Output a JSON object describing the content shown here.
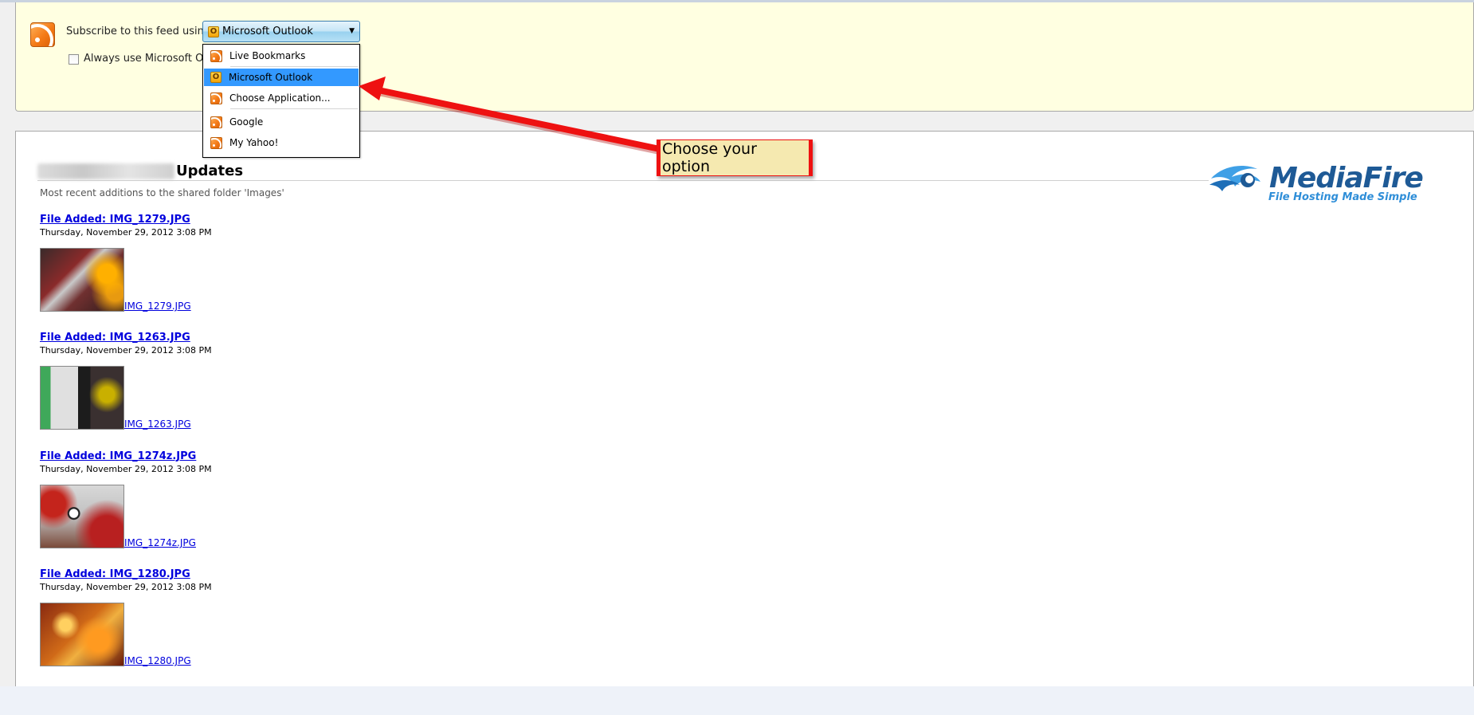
{
  "subscribe": {
    "label": "Subscribe to this feed using",
    "selected_value": "Microsoft Outlook",
    "always_use_label": "Always use Microsoft Outlook to subscribe to feeds.",
    "always_use_checked": false
  },
  "menu": {
    "items": [
      {
        "label": "Live Bookmarks",
        "icon": "rss-icon",
        "selected": false
      },
      {
        "label": "Microsoft Outlook",
        "icon": "outlook-icon",
        "selected": true
      },
      {
        "label": "Choose Application...",
        "icon": "rss-icon",
        "selected": false
      },
      {
        "label": "Google",
        "icon": "rss-icon",
        "selected": false
      },
      {
        "label": "My Yahoo!",
        "icon": "rss-icon",
        "selected": false
      }
    ]
  },
  "feed": {
    "title": "Updates",
    "subtitle": "Most recent additions to the shared folder 'Images'",
    "entries": [
      {
        "title": "File Added: IMG_1279.JPG",
        "date": "Thursday, November 29, 2012 3:08 PM",
        "link": "IMG_1279.JPG"
      },
      {
        "title": "File Added: IMG_1263.JPG",
        "date": "Thursday, November 29, 2012 3:08 PM",
        "link": "IMG_1263.JPG"
      },
      {
        "title": "File Added: IMG_1274z.JPG",
        "date": "Thursday, November 29, 2012 3:08 PM",
        "link": "IMG_1274z.JPG"
      },
      {
        "title": "File Added: IMG_1280.JPG",
        "date": "Thursday, November 29, 2012 3:08 PM",
        "link": "IMG_1280.JPG"
      }
    ]
  },
  "logo": {
    "name": "MediaFire",
    "tagline": "File Hosting Made Simple"
  },
  "annotation": {
    "text": "Choose your option"
  },
  "colors": {
    "bar_background": "#ffffe1",
    "menu_selection": "#3399ff",
    "link": "#0000dd",
    "annotation_border": "#ee1111",
    "annotation_fill": "#ffe87a",
    "logo_blue": "#1e5a96"
  }
}
